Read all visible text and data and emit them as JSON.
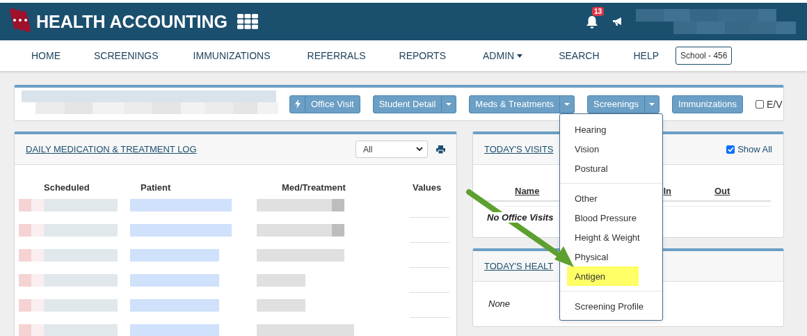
{
  "app": {
    "title": "HEALTH ACCOUNTING",
    "notifications": "13"
  },
  "nav": [
    {
      "label": "HOME",
      "kind": "link"
    },
    {
      "label": "SCREENINGS",
      "kind": "link"
    },
    {
      "label": "IMMUNIZATIONS",
      "kind": "link"
    },
    {
      "label": "REFERRALS",
      "kind": "link"
    },
    {
      "label": "REPORTS",
      "kind": "link"
    },
    {
      "label": "ADMIN",
      "kind": "dropdown"
    },
    {
      "label": "SEARCH",
      "kind": "link"
    },
    {
      "label": "HELP",
      "kind": "link"
    }
  ],
  "school": "School - 456",
  "toolbar": {
    "buttons": [
      {
        "label": "Office Visit",
        "kind": "icon"
      },
      {
        "label": "Student Detail",
        "kind": "split"
      },
      {
        "label": "Meds & Treatments",
        "kind": "split"
      },
      {
        "label": "Screenings",
        "kind": "split"
      },
      {
        "label": "Immunizations",
        "kind": "plain"
      }
    ],
    "ev": {
      "label": "E/V",
      "checked": false
    }
  },
  "med_log": {
    "title": "DAILY MEDICATION & TREATMENT LOG",
    "filter": "All",
    "columns": [
      "Scheduled",
      "Patient",
      "Med/Treatment",
      "Values"
    ]
  },
  "visits": {
    "title": "TODAY'S VISITS",
    "show_all": {
      "label": "Show All",
      "checked": true
    },
    "columns": [
      "Name",
      "In",
      "Out"
    ],
    "empty": "No Office Visits"
  },
  "health": {
    "title": "TODAY'S HEALT",
    "empty": "None"
  },
  "screenings_menu": [
    {
      "items": [
        {
          "label": "Hearing",
          "highlighted": false
        },
        {
          "label": "Vision",
          "highlighted": false
        },
        {
          "label": "Postural",
          "highlighted": false
        }
      ]
    },
    {
      "items": [
        {
          "label": "Other",
          "highlighted": false
        },
        {
          "label": "Blood Pressure",
          "highlighted": false
        },
        {
          "label": "Height & Weight",
          "highlighted": false
        },
        {
          "label": "Physical",
          "highlighted": false
        },
        {
          "label": "Antigen",
          "highlighted": true
        }
      ]
    },
    {
      "items": [
        {
          "label": "Screening Profile",
          "highlighted": false
        }
      ]
    }
  ]
}
